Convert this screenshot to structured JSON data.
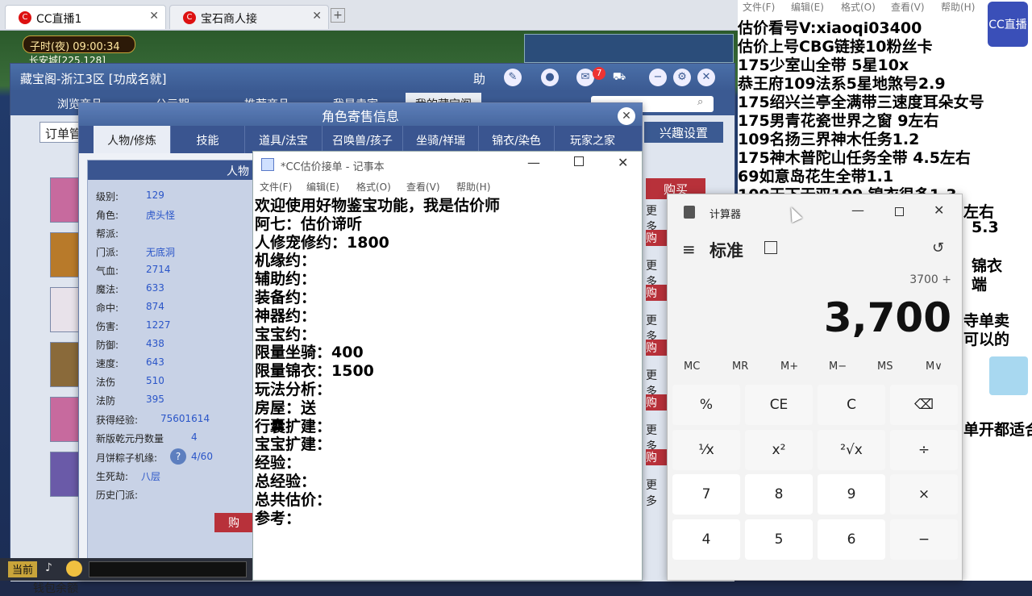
{
  "browser": {
    "tabs": [
      {
        "label": "CC直播1"
      },
      {
        "label": "宝石商人接"
      }
    ],
    "new_tab": "+"
  },
  "game": {
    "clock": "子时(夜)  09:00:34",
    "location": "长安城[225,128]",
    "current_label": "当前",
    "wallet_label": "钱包余额"
  },
  "cbg": {
    "title": "藏宝阁-浙江3区 [功成名就]",
    "help": "助",
    "msg_count": "7",
    "nav": [
      "浏览商品",
      "公示期",
      "推荐商品",
      "我是卖家",
      "我的藏宝阁"
    ],
    "order_label": "订单管",
    "interest_label": "兴趣设置",
    "buy_label": "购买",
    "more_label": "更多",
    "row_items": [
      "购",
      "更多",
      "购",
      "更多",
      "购",
      "更多",
      "购",
      "更多",
      "购",
      "更多",
      "购",
      "更多"
    ]
  },
  "role_dialog": {
    "title": "角色寄售信息",
    "tabs": [
      "人物/修炼",
      "技能",
      "道具/法宝",
      "召唤兽/孩子",
      "坐骑/祥瑞",
      "锦衣/染色",
      "玩家之家"
    ],
    "panel_header": "人物",
    "stats": [
      {
        "k": "级别:",
        "v": "129"
      },
      {
        "k": "角色:",
        "v": "虎头怪"
      },
      {
        "k": "帮派:",
        "v": ""
      },
      {
        "k": "门派:",
        "v": "无底洞"
      },
      {
        "k": "气血:",
        "v": "2714"
      },
      {
        "k": "魔法:",
        "v": "633"
      },
      {
        "k": "命中:",
        "v": "874"
      },
      {
        "k": "伤害:",
        "v": "1227"
      },
      {
        "k": "防御:",
        "v": "438"
      },
      {
        "k": "速度:",
        "v": "643"
      },
      {
        "k": "法伤",
        "v": "510"
      },
      {
        "k": "法防",
        "v": "395"
      },
      {
        "k": "获得经验:",
        "v": "75601614"
      },
      {
        "k": "新版乾元丹数量",
        "v": "4"
      },
      {
        "k": "月饼粽子机缘:",
        "v": "4/60"
      },
      {
        "k": "生死劫:",
        "v": "八层"
      },
      {
        "k": "历史门派:",
        "v": ""
      }
    ],
    "buy_btn": "购"
  },
  "notepad": {
    "title": "*CC估价接单 - 记事本",
    "menu": [
      "文件(F)",
      "编辑(E)",
      "格式(O)",
      "查看(V)",
      "帮助(H)"
    ],
    "lines": [
      "欢迎使用好物鉴宝功能，我是估价师",
      "阿七：估价谛听",
      "人修宠修约：1800",
      "机缘约：",
      "辅助约：",
      "装备约：",
      "神器约：",
      "宝宝约：",
      "限量坐骑：400",
      "限量锦衣：1500",
      "玩法分析：",
      "房屋：送",
      "行囊扩建：",
      "宝宝扩建：",
      "经验：",
      "总经验：",
      "总共估价：",
      "参考："
    ]
  },
  "calculator": {
    "title": "计算器",
    "mode": "标准",
    "expression": "3700 +",
    "display": "3,700",
    "memory": [
      "MC",
      "MR",
      "M+",
      "M−",
      "MS",
      "M∨"
    ],
    "keys": [
      [
        "%",
        "CE",
        "C",
        "⌫"
      ],
      [
        "¹⁄x",
        "x²",
        "²√x",
        "÷"
      ],
      [
        "7",
        "8",
        "9",
        "×"
      ],
      [
        "4",
        "5",
        "6",
        "−"
      ]
    ]
  },
  "overlay": {
    "menu": [
      "文件(F)",
      "编辑(E)",
      "格式(O)",
      "查看(V)",
      "帮助(H)"
    ],
    "logo": "CC直播",
    "lines": [
      "估价看号V:xiaoqi03400",
      "估价上号CBG链接10粉丝卡",
      "175少室山全带  5星10x",
      "恭王府109法系5星地煞号2.9",
      "175绍兴兰亭全满带三速度耳朵女号",
      "175男青花瓷世界之窗  9左右",
      "109名扬三界神木任务1.2",
      "175神木普陀山任务全带 4.5左右",
      "69如意岛花生全带1.1",
      "109天下无双109   锦衣很多1.3"
    ],
    "right_fragments": [
      "左右",
      "5.3",
      "锦衣",
      "端",
      "寺单卖",
      "可以的",
      "单开都适合"
    ]
  }
}
